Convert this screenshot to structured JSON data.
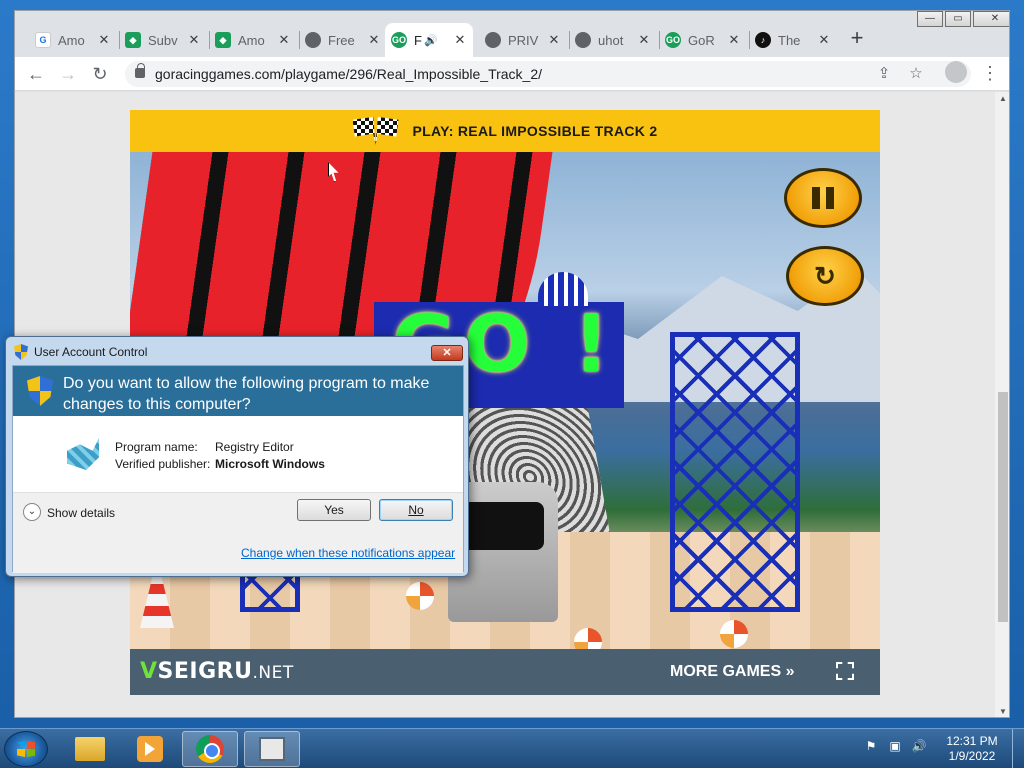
{
  "browser": {
    "tabs": [
      {
        "title": "Amo",
        "favicon": "gb-icon",
        "active": false
      },
      {
        "title": "Subv",
        "favicon": "gamepad-icon",
        "active": false
      },
      {
        "title": "Amo",
        "favicon": "gamepad-icon",
        "active": false
      },
      {
        "title": "Free",
        "favicon": "globe-icon",
        "active": false
      },
      {
        "title": "F",
        "favicon": "go-icon",
        "active": true,
        "audio": true
      },
      {
        "title": "PRIV",
        "favicon": "globe-icon",
        "active": false
      },
      {
        "title": "uhot",
        "favicon": "globe-icon",
        "active": false
      },
      {
        "title": "GoR",
        "favicon": "go-icon",
        "active": false
      },
      {
        "title": "The",
        "favicon": "tiktok-icon",
        "active": false
      }
    ],
    "new_tab": "+",
    "url": "goracinggames.com/playgame/296/Real_Impossible_Track_2/",
    "win_minimize": "—",
    "win_maximize": "▭",
    "win_close": "✕"
  },
  "game": {
    "header_title": "PLAY: REAL IMPOSSIBLE TRACK 2",
    "go_text": "GO !",
    "footer_brand_v": "V",
    "footer_brand_mid": "SEIGRU",
    "footer_brand_net": ".NET",
    "more_games": "MORE GAMES »"
  },
  "uac": {
    "window_title": "User Account Control",
    "close": "✕",
    "question": "Do you want to allow the following program to make changes to this computer?",
    "program_name_label": "Program name:",
    "program_name_value": "Registry Editor",
    "publisher_label": "Verified publisher:",
    "publisher_value": "Microsoft Windows",
    "show_details": "Show details",
    "yes": "Yes",
    "no": "No",
    "change_link": "Change when these notifications appear"
  },
  "taskbar": {
    "apps": [
      "explorer-icon",
      "media-player-icon",
      "chrome-icon",
      "registry-editor-icon"
    ],
    "time": "12:31 PM",
    "date": "1/9/2022"
  },
  "colors": {
    "game_header": "#f9c210",
    "go_text": "#25ff3a",
    "uac_banner": "#2a6f9a",
    "taskbar": "#1d4a7a"
  }
}
